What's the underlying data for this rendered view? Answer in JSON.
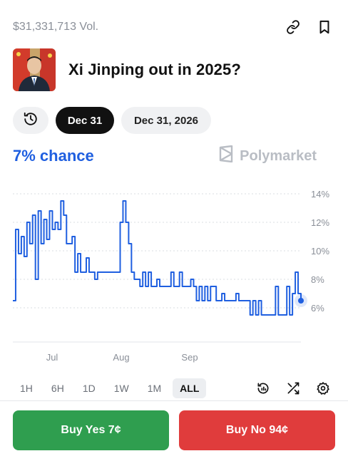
{
  "market": {
    "volume": "$31,331,713 Vol.",
    "title": "Xi Jinping out in 2025?",
    "chance": "7% chance",
    "brand": "Polymarket"
  },
  "dates": {
    "active": "Dec 31",
    "other": "Dec 31, 2026"
  },
  "ranges": [
    "1H",
    "6H",
    "1D",
    "1W",
    "1M",
    "ALL"
  ],
  "active_range": "ALL",
  "buttons": {
    "yes": "Buy Yes 7¢",
    "no": "Buy No 94¢"
  },
  "colors": {
    "accent": "#1f5fe0",
    "yes": "#2f9e4f",
    "no": "#e03c3c"
  },
  "chart_data": {
    "type": "line",
    "y_ticks": [
      "14%",
      "12%",
      "10%",
      "8%",
      "6%"
    ],
    "x_ticks": [
      "Jul",
      "Aug",
      "Sep"
    ],
    "ylim": [
      6,
      14
    ],
    "grid": true,
    "series": [
      {
        "values": [
          6.5,
          11.5,
          9.8,
          11.0,
          9.6,
          12.0,
          10.5,
          12.5,
          8.0,
          12.8,
          10.5,
          12.2,
          10.8,
          12.8,
          11.5,
          12.0,
          11.5,
          13.5,
          12.5,
          10.5,
          10.5,
          11.0,
          8.5,
          9.8,
          8.5,
          8.5,
          9.5,
          8.5,
          8.5,
          8.0,
          8.5,
          8.5,
          8.5,
          8.5,
          8.5,
          8.5,
          8.5,
          8.5,
          12.0,
          13.5,
          12.0,
          10.5,
          8.5,
          8.0,
          8.0,
          7.5,
          8.5,
          7.5,
          8.5,
          7.5,
          7.5,
          8.0,
          7.5,
          7.5,
          7.5,
          7.5,
          8.5,
          7.5,
          7.5,
          8.5,
          7.5,
          7.5,
          7.5,
          8.0,
          7.5,
          6.5,
          7.5,
          6.5,
          7.5,
          6.5,
          7.5,
          7.5,
          6.5,
          6.5,
          7.0,
          6.5,
          6.5,
          6.5,
          6.5,
          7.0,
          6.5,
          6.5,
          6.5,
          6.5,
          5.5,
          6.5,
          5.5,
          6.5,
          5.5,
          5.5,
          5.5,
          5.5,
          5.5,
          7.5,
          5.5,
          5.5,
          5.5,
          7.5,
          5.5,
          7.0,
          8.5,
          7.0,
          6.5
        ]
      }
    ]
  }
}
